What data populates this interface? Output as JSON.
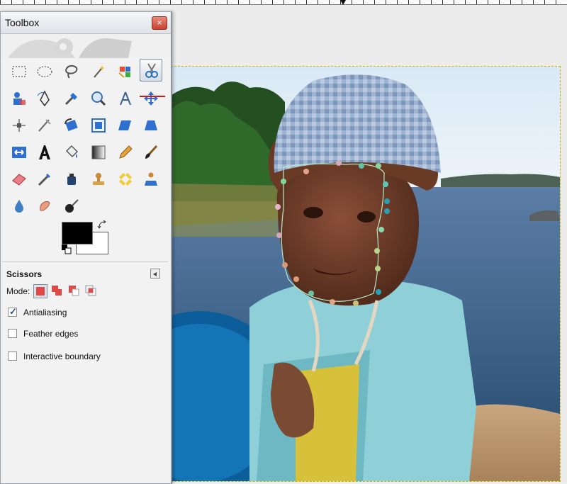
{
  "toolbox": {
    "title": "Toolbox",
    "close_label": "×",
    "tool_options": {
      "title": "Scissors",
      "mode_label": "Mode:",
      "options": [
        {
          "label": "Antialiasing",
          "checked": true
        },
        {
          "label": "Feather edges",
          "checked": false
        },
        {
          "label": "Interactive boundary",
          "checked": false
        }
      ]
    },
    "colors": {
      "foreground": "#000000",
      "background": "#ffffff"
    },
    "active_tool": "scissors-select"
  }
}
